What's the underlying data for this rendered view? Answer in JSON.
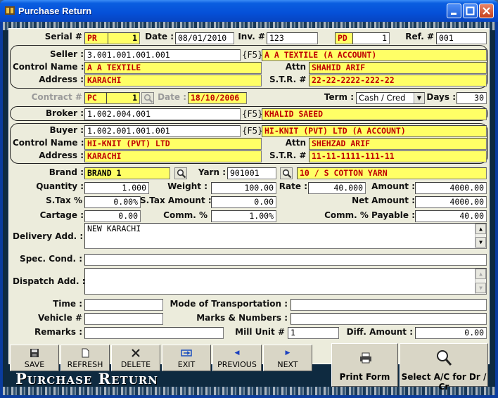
{
  "window": {
    "title": "Purchase Return"
  },
  "header": {
    "serial_label": "Serial #",
    "serial_prefix": "PR",
    "serial_no": "1",
    "date_label": "Date :",
    "date": "08/01/2010",
    "inv_label": "Inv. #",
    "inv": "123",
    "pd_prefix": "PD",
    "pd_no": "1",
    "ref_label": "Ref. #",
    "ref": "001"
  },
  "seller": {
    "seller_label": "Seller :",
    "seller_code": "3.001.001.001.001",
    "f5": "{F5}",
    "seller_name": "A A TEXTILE (A ACCOUNT)",
    "control_label": "Control Name :",
    "control_name": "A A TEXTILE",
    "attn_label": "Attn",
    "attn": "SHAHID ARIF",
    "address_label": "Address :",
    "address": "KARACHI",
    "str_label": "S.T.R. #",
    "str": "22-22-2222-222-22"
  },
  "contract": {
    "contract_label": "Contract #",
    "contract_prefix": "PC",
    "contract_no": "1",
    "date_label": "Date :",
    "date": "18/10/2006",
    "term_label": "Term :",
    "term": "Cash / Cred",
    "days_label": "Days :",
    "days": "30"
  },
  "broker": {
    "label": "Broker :",
    "code": "1.002.004.001",
    "f5": "{F5}",
    "name": "KHALID SAEED"
  },
  "buyer": {
    "buyer_label": "Buyer :",
    "buyer_code": "1.002.001.001.001",
    "f5": "{F5}",
    "buyer_name": "HI-KNIT (PVT) LTD (A ACCOUNT)",
    "control_label": "Control Name :",
    "control_name": "HI-KNIT (PVT) LTD",
    "attn_label": "Attn",
    "attn": "SHEHZAD ARIF",
    "address_label": "Address :",
    "address": "KARACHI",
    "str_label": "S.T.R. #",
    "str": "11-11-1111-111-11"
  },
  "goods": {
    "brand_label": "Brand :",
    "brand": "BRAND 1",
    "yarn_label": "Yarn :",
    "yarn_code": "901001",
    "yarn_desc": "10 / S COTTON YARN",
    "quantity_label": "Quantity :",
    "quantity": "1.000",
    "weight_label": "Weight :",
    "weight": "100.00",
    "rate_label": "Rate :",
    "rate": "40.000",
    "amount_label": "Amount :",
    "amount": "4000.00",
    "stax_pct_label": "S.Tax %",
    "stax_pct": "0.00%",
    "stax_amt_label": "S.Tax Amount :",
    "stax_amt": "0.00",
    "net_label": "Net Amount :",
    "net": "4000.00",
    "cartage_label": "Cartage :",
    "cartage": "0.00",
    "comm_pct_label": "Comm. %",
    "comm_pct": "1.00%",
    "comm_pay_label": "Comm. % Payable :",
    "comm_pay": "40.00"
  },
  "details": {
    "delivery_label": "Delivery Add. :",
    "delivery": "NEW KARACHI",
    "spec_label": "Spec. Cond. :",
    "spec": "",
    "dispatch_label": "Dispatch Add. :",
    "dispatch": "",
    "time_label": "Time :",
    "time": "",
    "mode_label": "Mode of Transportation :",
    "mode": "",
    "vehicle_label": "Vehicle #",
    "vehicle": "",
    "marks_label": "Marks & Numbers :",
    "marks": "",
    "remarks_label": "Remarks :",
    "remarks": "",
    "mill_label": "Mill Unit #",
    "mill": "1",
    "diff_label": "Diff. Amount :",
    "diff": "0.00"
  },
  "toolbar": {
    "save": "SAVE",
    "refresh": "REFRESH",
    "delete": "DELETE",
    "exit": "EXIT",
    "previous": "PREVIOUS",
    "next": "NEXT",
    "print": "Print Form",
    "select": "Select A/C for Dr / Cr",
    "brand": "Purchase Return"
  },
  "icons": [
    "app-icon",
    "minimize-icon",
    "maximize-icon",
    "close-icon",
    "magnifier-icon",
    "dropdown-arrow-icon",
    "save-icon",
    "refresh-icon",
    "delete-icon",
    "exit-icon",
    "previous-icon",
    "next-icon",
    "printer-icon",
    "search-icon"
  ],
  "colors": {
    "titlebar": "#0550d8",
    "panel": "#ececdc",
    "highlight_field": "#ffff66",
    "highlight_text": "#c00000"
  }
}
